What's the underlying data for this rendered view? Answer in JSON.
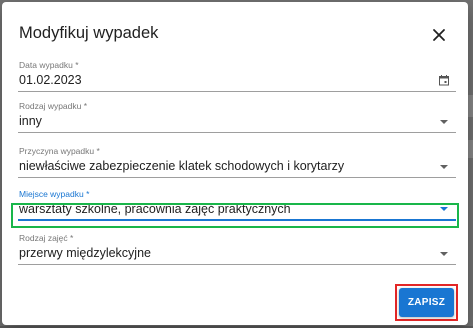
{
  "dialog": {
    "title": "Modyfikuj wypadek",
    "close_icon": "close-icon"
  },
  "fields": [
    {
      "label": "Data wypadku *",
      "value": "01.02.2023",
      "control": "date",
      "icon": "calendar-icon"
    },
    {
      "label": "Rodzaj wypadku *",
      "value": "inny",
      "control": "select",
      "icon": "chevron-down-icon"
    },
    {
      "label": "Przyczyna wypadku *",
      "value": "niewłaściwe zabezpieczenie klatek schodowych i korytarzy",
      "control": "select",
      "icon": "chevron-down-icon"
    },
    {
      "label": "Miejsce wypadku *",
      "value": "warsztaty szkolne, pracownia zajęć praktycznych",
      "control": "select",
      "icon": "chevron-down-icon",
      "focused": true
    },
    {
      "label": "Rodzaj zajęć *",
      "value": "przerwy międzylekcyjne",
      "control": "select",
      "icon": "chevron-down-icon"
    }
  ],
  "actions": {
    "save_label": "ZAPISZ"
  },
  "colors": {
    "accent": "#1976d2",
    "highlight_green": "#19b64a",
    "highlight_red": "#e32626"
  }
}
